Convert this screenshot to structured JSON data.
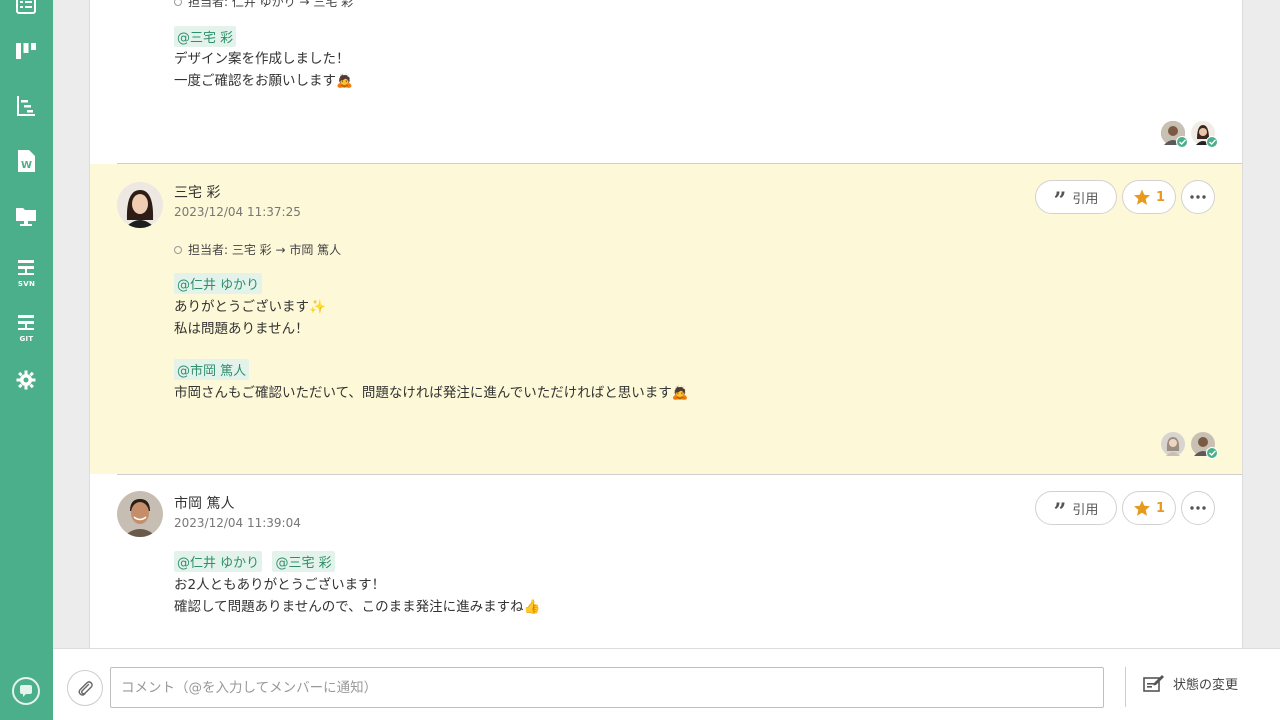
{
  "sidebar": {
    "items": [
      {
        "icon": "list-icon"
      },
      {
        "icon": "board-icon"
      },
      {
        "icon": "gantt-icon"
      },
      {
        "icon": "wiki-icon"
      },
      {
        "icon": "files-icon"
      },
      {
        "icon": "svn-icon",
        "label": "SVN"
      },
      {
        "icon": "git-icon",
        "label": "GIT"
      },
      {
        "icon": "gear-icon"
      }
    ],
    "help_icon": "chat-icon"
  },
  "comments": [
    {
      "change": "担当者: 仁井 ゆかり → 三宅 彩",
      "mentions": [
        "@三宅 彩"
      ],
      "lines": [
        "デザイン案を作成しました！",
        "一度ご確認をお願いします🙇"
      ]
    },
    {
      "author": "三宅 彩",
      "timestamp": "2023/12/04 11:37:25",
      "change": "担当者: 三宅 彩 → 市岡 篤人",
      "mention1": "@仁井 ゆかり",
      "lines1": [
        "ありがとうございます✨",
        "私は問題ありません！"
      ],
      "mention2": "@市岡 篤人",
      "lines2": [
        "市岡さんもご確認いただいて、問題なければ発注に進んでいただければと思います🙇"
      ],
      "quote_label": "引用",
      "star_count": "1"
    },
    {
      "author": "市岡 篤人",
      "timestamp": "2023/12/04 11:39:04",
      "mentions": [
        "@仁井 ゆかり",
        "@三宅 彩"
      ],
      "lines": [
        "お2人ともありがとうございます！",
        "確認して問題ありませんので、このまま発注に進みますね👍"
      ],
      "quote_label": "引用",
      "star_count": "1"
    }
  ],
  "composer": {
    "placeholder": "コメント（@を入力してメンバーに通知）",
    "status_change_label": "状態の変更"
  },
  "colors": {
    "brand": "#4caf8b",
    "highlight": "#fdf8d8",
    "star": "#e69b1e"
  }
}
